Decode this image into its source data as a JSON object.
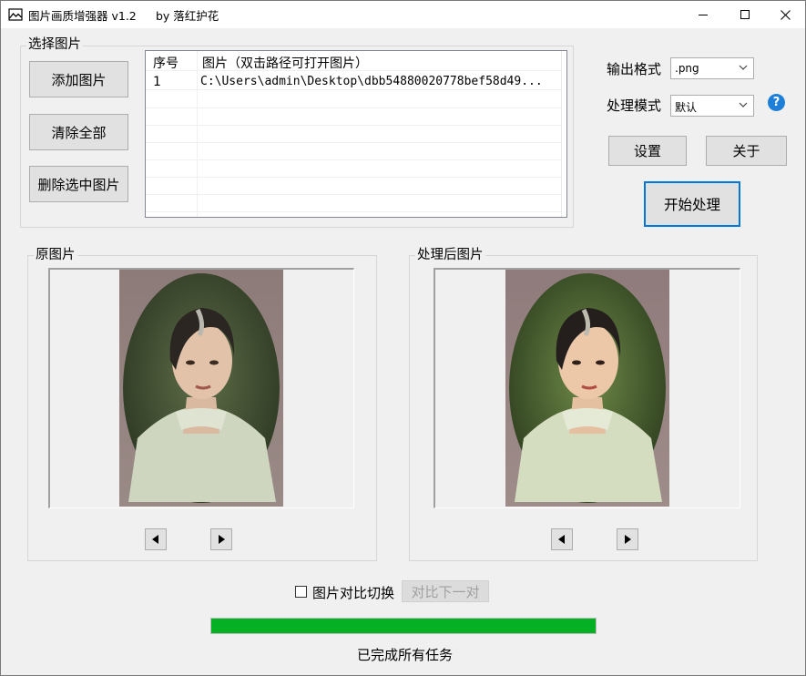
{
  "window": {
    "title": "图片画质增强器 v1.2",
    "author": "by 落红护花",
    "minimize_glyph": "—",
    "close_glyph": "✕"
  },
  "select_group": {
    "label": "选择图片",
    "add_button": "添加图片",
    "clear_button": "清除全部",
    "delete_selected_button": "删除选中图片"
  },
  "file_table": {
    "columns": [
      "序号",
      "图片（双击路径可打开图片）"
    ],
    "rows": [
      [
        "1",
        "C:\\Users\\admin\\Desktop\\dbb54880020778bef58d49..."
      ]
    ]
  },
  "settings": {
    "output_format_label": "输出格式",
    "output_format_value": ".png",
    "mode_label": "处理模式",
    "mode_value": "默认",
    "help_glyph": "?",
    "settings_button": "设置",
    "about_button": "关于",
    "start_button": "开始处理"
  },
  "original_group": {
    "label": "原图片"
  },
  "processed_group": {
    "label": "处理后图片"
  },
  "compare": {
    "checkbox_label": "图片对比切换",
    "checked": false,
    "next_pair_button": "对比下一对"
  },
  "progress": {
    "fraction": 1.0,
    "color": "#06b025",
    "status_text": "已完成所有任务"
  },
  "icons": {
    "app": "app-picture-icon",
    "prev": "triangle-left-icon",
    "next": "triangle-right-icon",
    "dropdown": "chevron-down-icon"
  }
}
